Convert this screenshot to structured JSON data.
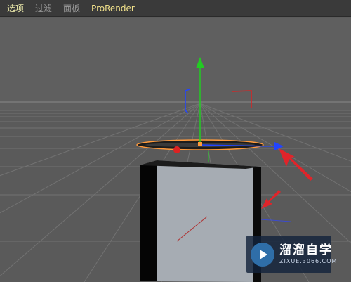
{
  "menubar": {
    "items": [
      {
        "label": "选项"
      },
      {
        "label": "过滤"
      },
      {
        "label": "面板"
      },
      {
        "label": "ProRender"
      }
    ]
  },
  "viewport": {
    "background": "#5f5f5f",
    "grid_color": "#707070",
    "gizmo_colors": {
      "y_axis": "#22cc22",
      "x_axis": "#2244ff",
      "z_axis": "#dd2222",
      "selection": "#ff9a3c"
    },
    "annotation_color": "#e0242a",
    "cube_face_color": "#a6acb3"
  },
  "watermark": {
    "title": "溜溜自学",
    "subtitle": "ZIXUE.3066.COM"
  }
}
